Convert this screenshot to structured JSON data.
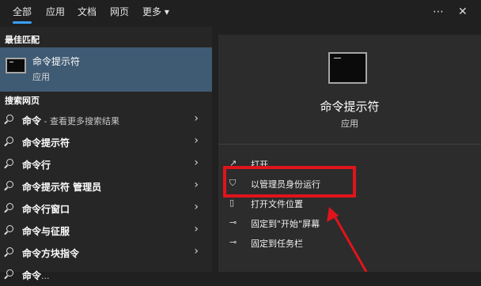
{
  "tabs": [
    {
      "label": "全部",
      "active": true
    },
    {
      "label": "应用"
    },
    {
      "label": "文档"
    },
    {
      "label": "网页"
    },
    {
      "label": "更多 ▾"
    }
  ],
  "top_icons": [
    "more-icon",
    "close-icon"
  ],
  "left": {
    "best_match_label": "最佳匹配",
    "best_match": {
      "title": "命令提示符",
      "subtitle": "应用"
    },
    "web_label": "搜索网页",
    "web_items": [
      {
        "bold": "命令",
        "rest": " - 查看更多搜索结果"
      },
      {
        "bold": "命令提示符",
        "rest": ""
      },
      {
        "bold": "命令行",
        "rest": ""
      },
      {
        "bold": "命令提示符 管理员",
        "rest": ""
      },
      {
        "bold": "命令行窗口",
        "rest": ""
      },
      {
        "bold": "命令与征服",
        "rest": ""
      },
      {
        "bold": "命令方块指令",
        "rest": ""
      },
      {
        "bold": "命令",
        "rest": "..."
      }
    ]
  },
  "detail": {
    "title": "命令提示符",
    "type": "应用",
    "actions": [
      {
        "label": "打开",
        "icon": "open-icon"
      },
      {
        "label": "以管理员身份运行",
        "icon": "shield-icon"
      },
      {
        "label": "打开文件位置",
        "icon": "file-location-icon"
      },
      {
        "label": "固定到\"开始\"屏幕",
        "icon": "pin-icon"
      },
      {
        "label": "固定到任务栏",
        "icon": "pin-icon"
      }
    ]
  },
  "colors": {
    "accent": "#3aa0ff",
    "highlight": "#e0141b",
    "selected_bg": "#3f5a73"
  }
}
